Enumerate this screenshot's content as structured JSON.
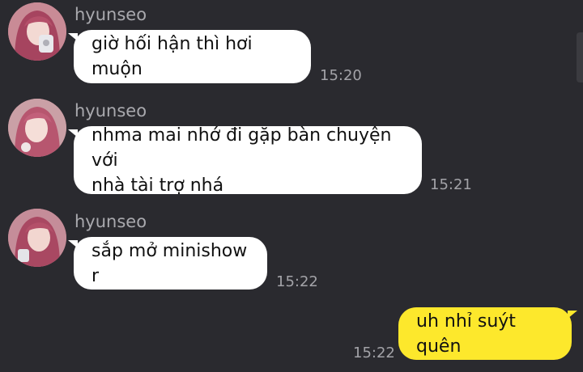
{
  "colors": {
    "background": "#2a2a2f",
    "incoming_bubble": "#ffffff",
    "outgoing_bubble": "#fde82c",
    "sender_name": "#a9a9ae",
    "timestamp": "#a3a3a8"
  },
  "messages": [
    {
      "sender": "hyunseo",
      "lines": [
        "giờ hối hận thì hơi muộn"
      ],
      "time": "15:20",
      "direction": "incoming",
      "avatar_icon": "profile-photo-icon"
    },
    {
      "sender": "hyunseo",
      "lines": [
        "nhma mai nhớ đi gặp bàn chuyện với",
        "nhà tài trợ nhá"
      ],
      "time": "15:21",
      "direction": "incoming",
      "avatar_icon": "profile-photo-icon"
    },
    {
      "sender": "hyunseo",
      "lines": [
        "sắp mở minishow r"
      ],
      "time": "15:22",
      "direction": "incoming",
      "avatar_icon": "profile-photo-icon"
    },
    {
      "lines": [
        "uh nhỉ suýt quên"
      ],
      "time": "15:22",
      "direction": "outgoing"
    }
  ]
}
